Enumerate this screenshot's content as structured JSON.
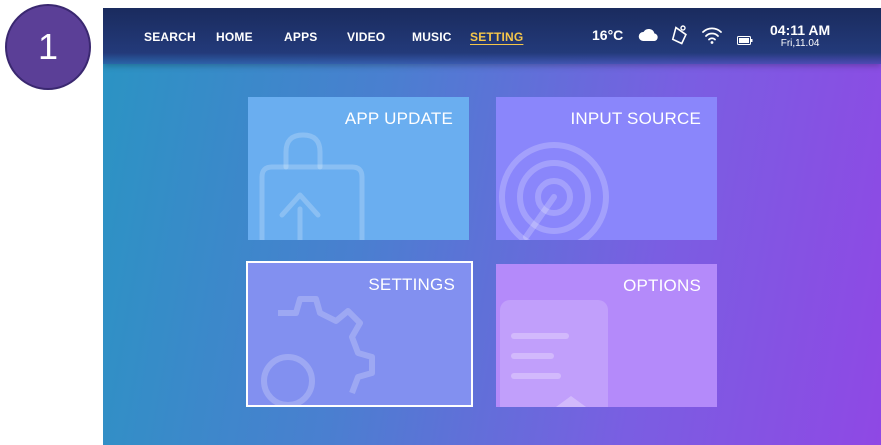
{
  "step_number": "1",
  "nav": {
    "items": [
      {
        "label": "SEARCH",
        "active": false
      },
      {
        "label": "HOME",
        "active": false
      },
      {
        "label": "APPS",
        "active": false
      },
      {
        "label": "VIDEO",
        "active": false
      },
      {
        "label": "MUSIC",
        "active": false
      },
      {
        "label": "SETTING",
        "active": true
      }
    ]
  },
  "status": {
    "temperature": "16°C",
    "weather_icon": "cloud-icon",
    "icons": [
      "compass-icon",
      "wifi-icon",
      "battery-icon"
    ],
    "time": "04:11 AM",
    "date": "Fri,11.04"
  },
  "tiles": [
    {
      "label": "APP UPDATE",
      "icon": "shopping-bag-upload-icon",
      "color": "#6aaef0",
      "focused": false
    },
    {
      "label": "INPUT SOURCE",
      "icon": "signal-source-icon",
      "color": "#8a86fb",
      "focused": false
    },
    {
      "label": "SETTINGS",
      "icon": "gear-icon",
      "color": "#8290f0",
      "focused": true
    },
    {
      "label": "OPTIONS",
      "icon": "document-list-icon",
      "color": "#b48afa",
      "focused": false
    }
  ],
  "colors": {
    "active_nav": "#f5c64a",
    "badge": "#5b3f97"
  }
}
